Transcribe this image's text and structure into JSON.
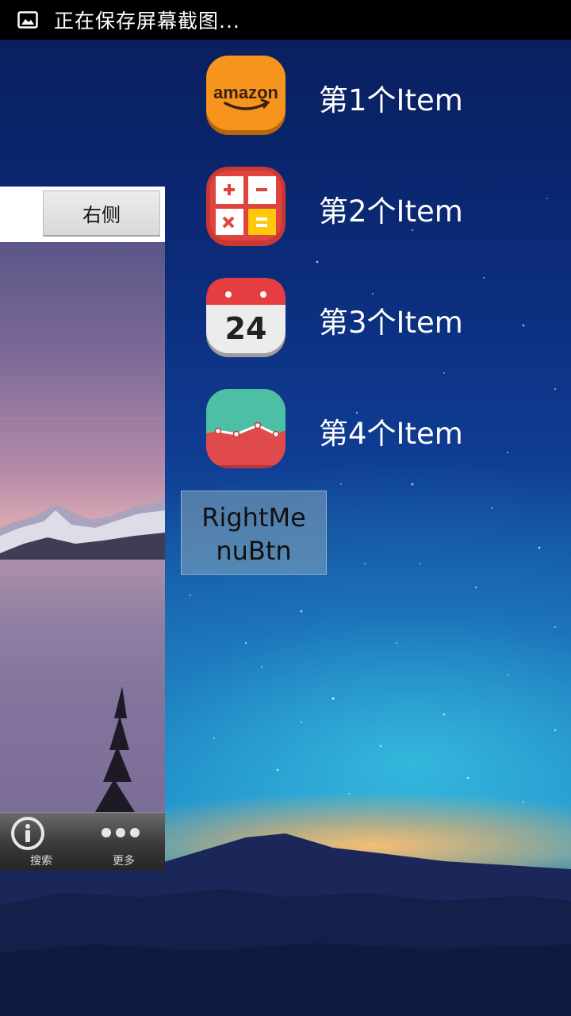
{
  "status_bar": {
    "text": "正在保存屏幕截图...",
    "icon": "image-icon"
  },
  "main_panel": {
    "right_button_label": "右侧",
    "tabs": [
      {
        "label": "搜索",
        "icon": "info-icon"
      },
      {
        "label": "更多",
        "icon": "more-dots-icon"
      }
    ]
  },
  "right_menu": {
    "items": [
      {
        "label": "第1个Item",
        "icon": "amazon-icon",
        "icon_text": "amazon"
      },
      {
        "label": "第2个Item",
        "icon": "calculator-icon"
      },
      {
        "label": "第3个Item",
        "icon": "calendar-icon",
        "icon_text": "24"
      },
      {
        "label": "第4个Item",
        "icon": "chart-icon"
      }
    ],
    "button_line1": "RightMe",
    "button_line2": "nuBtn"
  },
  "colors": {
    "amazon_orange": "#f7941d",
    "calc_red": "#e0443e",
    "calc_yellow": "#ffc80a",
    "calendar_red": "#e43d42",
    "chart_teal": "#4dbfa5"
  }
}
